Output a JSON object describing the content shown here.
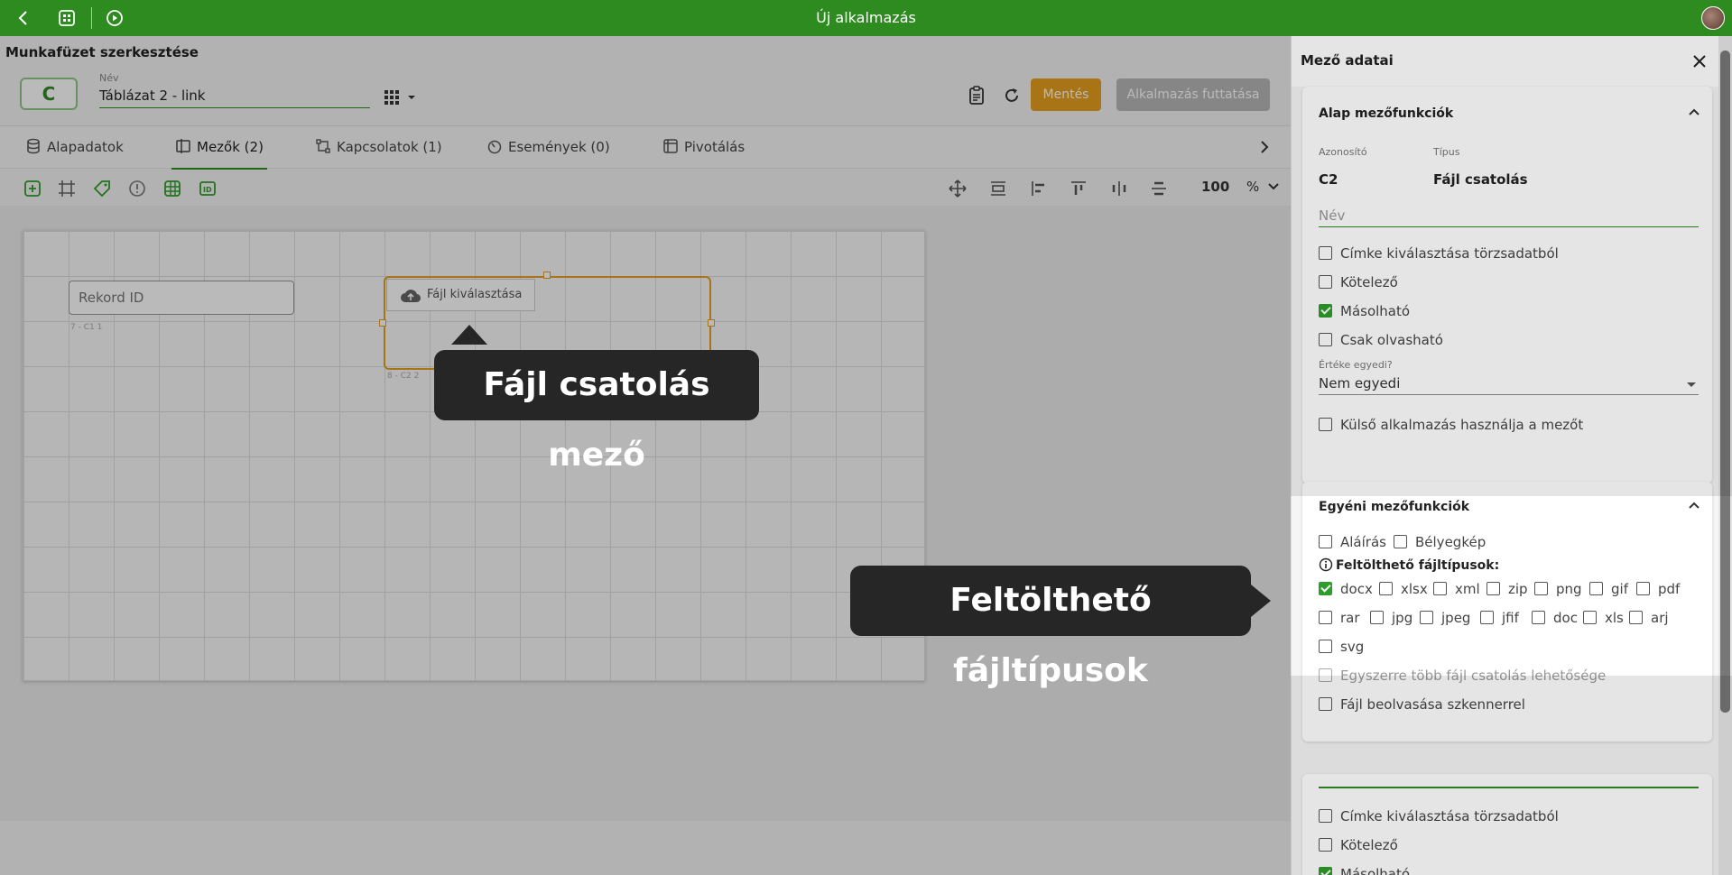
{
  "app": {
    "title": "Új alkalmazás"
  },
  "header": {
    "page_title": "Munkafüzet szerkesztése",
    "id_badge": "C",
    "name_label": "Név",
    "name_value": "Táblázat 2 - link",
    "save_label": "Mentés",
    "run_label": "Alkalmazás futtatása"
  },
  "tabs": [
    {
      "label": "Alapadatok"
    },
    {
      "label": "Mezők (2)"
    },
    {
      "label": "Kapcsolatok (1)"
    },
    {
      "label": "Események (0)"
    },
    {
      "label": "Pivotálás"
    }
  ],
  "toolbar": {
    "zoom": "100",
    "zoom_unit": "%"
  },
  "canvas": {
    "record_field": "Rekord ID",
    "record_meta": "7 - C1   1",
    "file_button": "Fájl kiválasztása",
    "file_meta": "8 - C2   2"
  },
  "tooltips": {
    "field": "Fájl csatolás mező",
    "filetypes": "Feltölthető fájltípusok"
  },
  "panel": {
    "title": "Mező adatai",
    "basic": {
      "title": "Alap mezőfunkciók",
      "id_label": "Azonosító",
      "id_value": "C2",
      "type_label": "Típus",
      "type_value": "Fájl csatolás",
      "name_placeholder": "Név",
      "checks": [
        {
          "label": "Címke kiválasztása törzsadatból",
          "checked": false
        },
        {
          "label": "Kötelező",
          "checked": false
        },
        {
          "label": "Másolható",
          "checked": true
        },
        {
          "label": "Csak olvasható",
          "checked": false
        }
      ],
      "unique_label": "Értéke egyedi?",
      "unique_value": "Nem egyedi",
      "external": "Külső alkalmazás használja a mezőt"
    },
    "custom": {
      "title": "Egyéni mezőfunkciók",
      "signature": "Aláírás",
      "thumbnail": "Bélyegkép",
      "filetypes_label": "Feltölthető fájltípusok:",
      "filetypes": [
        {
          "label": "docx",
          "checked": true
        },
        {
          "label": "xlsx",
          "checked": false
        },
        {
          "label": "xml",
          "checked": false
        },
        {
          "label": "zip",
          "checked": false
        },
        {
          "label": "png",
          "checked": false
        },
        {
          "label": "gif",
          "checked": false
        },
        {
          "label": "pdf",
          "checked": false
        },
        {
          "label": "rar",
          "checked": false
        },
        {
          "label": "jpg",
          "checked": false
        },
        {
          "label": "jpeg",
          "checked": false
        },
        {
          "label": "jfif",
          "checked": false
        },
        {
          "label": "doc",
          "checked": false
        },
        {
          "label": "xls",
          "checked": false
        },
        {
          "label": "arj",
          "checked": false
        },
        {
          "label": "svg",
          "checked": false
        }
      ],
      "multi": "Egyszerre több fájl csatolás lehetősége",
      "scanner": "Fájl beolvasása szkennerrel"
    },
    "next": {
      "checks": [
        {
          "label": "Címke kiválasztása törzsadatból"
        },
        {
          "label": "Kötelező"
        },
        {
          "label": "Másolható"
        }
      ]
    }
  }
}
